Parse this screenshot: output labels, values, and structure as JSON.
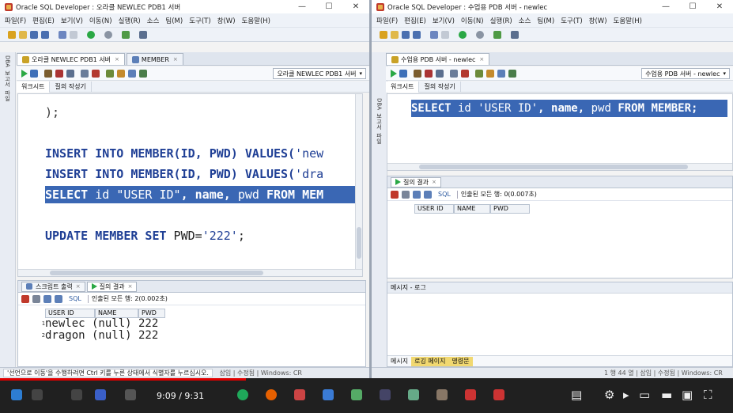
{
  "left_window": {
    "title": "Oracle SQL Developer : 오라클 NEWLEC PDB1 서버",
    "menu": [
      "파일(F)",
      "편집(E)",
      "보기(V)",
      "이동(N)",
      "실행(R)",
      "소스",
      "팀(M)",
      "도구(T)",
      "창(W)",
      "도움말(H)"
    ],
    "tabs": [
      {
        "label": "오라클 NEWLEC PDB1 서버",
        "active": true
      },
      {
        "label": "MEMBER",
        "active": false
      }
    ],
    "connection": "오라클 NEWLEC PDB1 서버",
    "subtabs": [
      "워크시트",
      "질의 작성기"
    ],
    "side_labels": [
      "DBA",
      "보고서",
      "파일"
    ],
    "code": {
      "line1": ");",
      "line2_kw": "INSERT INTO MEMBER(ID, PWD) VALUES(",
      "line2_str": "'new",
      "line3_kw": "INSERT INTO MEMBER(ID, PWD) VALUES(",
      "line3_str": "'dra",
      "line4_a": "SELECT",
      "line4_b": " id ",
      "line4_c": "\"USER ID\"",
      "line4_d": ", name, ",
      "line4_e": "pwd",
      "line4_f": " FROM MEM",
      "line5_a": "UPDATE MEMBER SET",
      "line5_b": " PWD=",
      "line5_c": "'222'",
      "line5_d": ";"
    },
    "output_tabs": [
      {
        "label": "스크립트 출력",
        "active": false
      },
      {
        "label": "질의 결과",
        "active": true
      }
    ],
    "fetch_status": "인출된 모든 행: 2(0.002초)",
    "sql_label": "SQL",
    "columns": [
      "USER ID",
      "NAME",
      "PWD"
    ],
    "rows": [
      {
        "num": "1",
        "text": "newlec (null) 222"
      },
      {
        "num": "2",
        "text": "dragon (null) 222"
      }
    ],
    "status_hint": "'선언으로 이동'을 수행하려면 Ctrl 키를 누른 상태에서 식별자를 누르십시오.",
    "status_tail": "삽입  |  수정됨  |  Windows: CR"
  },
  "right_window": {
    "title": "Oracle SQL Developer : 수업용 PDB 서버 - newlec",
    "menu": [
      "파일(F)",
      "편집(E)",
      "보기(V)",
      "이동(N)",
      "실행(R)",
      "소스",
      "팀(M)",
      "도구(T)",
      "창(W)",
      "도움말(H)"
    ],
    "tab": "수업용 PDB 서버 - newlec",
    "connection": "수업용 PDB 서버 - newlec",
    "subtabs": [
      "워크시트",
      "질의 작성기"
    ],
    "side_labels": [
      "DBA",
      "보고서",
      "파일"
    ],
    "code": {
      "a": "SELECT",
      "b": " id ",
      "c": "'USER ID'",
      "d": ", name, ",
      "e": "pwd",
      "f": " FROM MEMBER;"
    },
    "output_tab": "질의 결과",
    "fetch_status": "인출된 모든 행: 0(0.007초)",
    "sql_label": "SQL",
    "columns": [
      "USER ID",
      "NAME",
      "PWD"
    ],
    "messages_title": "메시지 - 로그",
    "message_tabs": [
      "메시지",
      "로깅 페이지",
      "명령문"
    ],
    "status_tail": "1 행 44 열  |  삽입  |  수정됨  |  Windows: CR"
  },
  "taskbar": {
    "timecode": "9:09 / 9:31",
    "progress": 0.336
  },
  "colors": {
    "selection": "#3a67b4",
    "keyword": "#1f3f95",
    "progress": "#e00000"
  }
}
